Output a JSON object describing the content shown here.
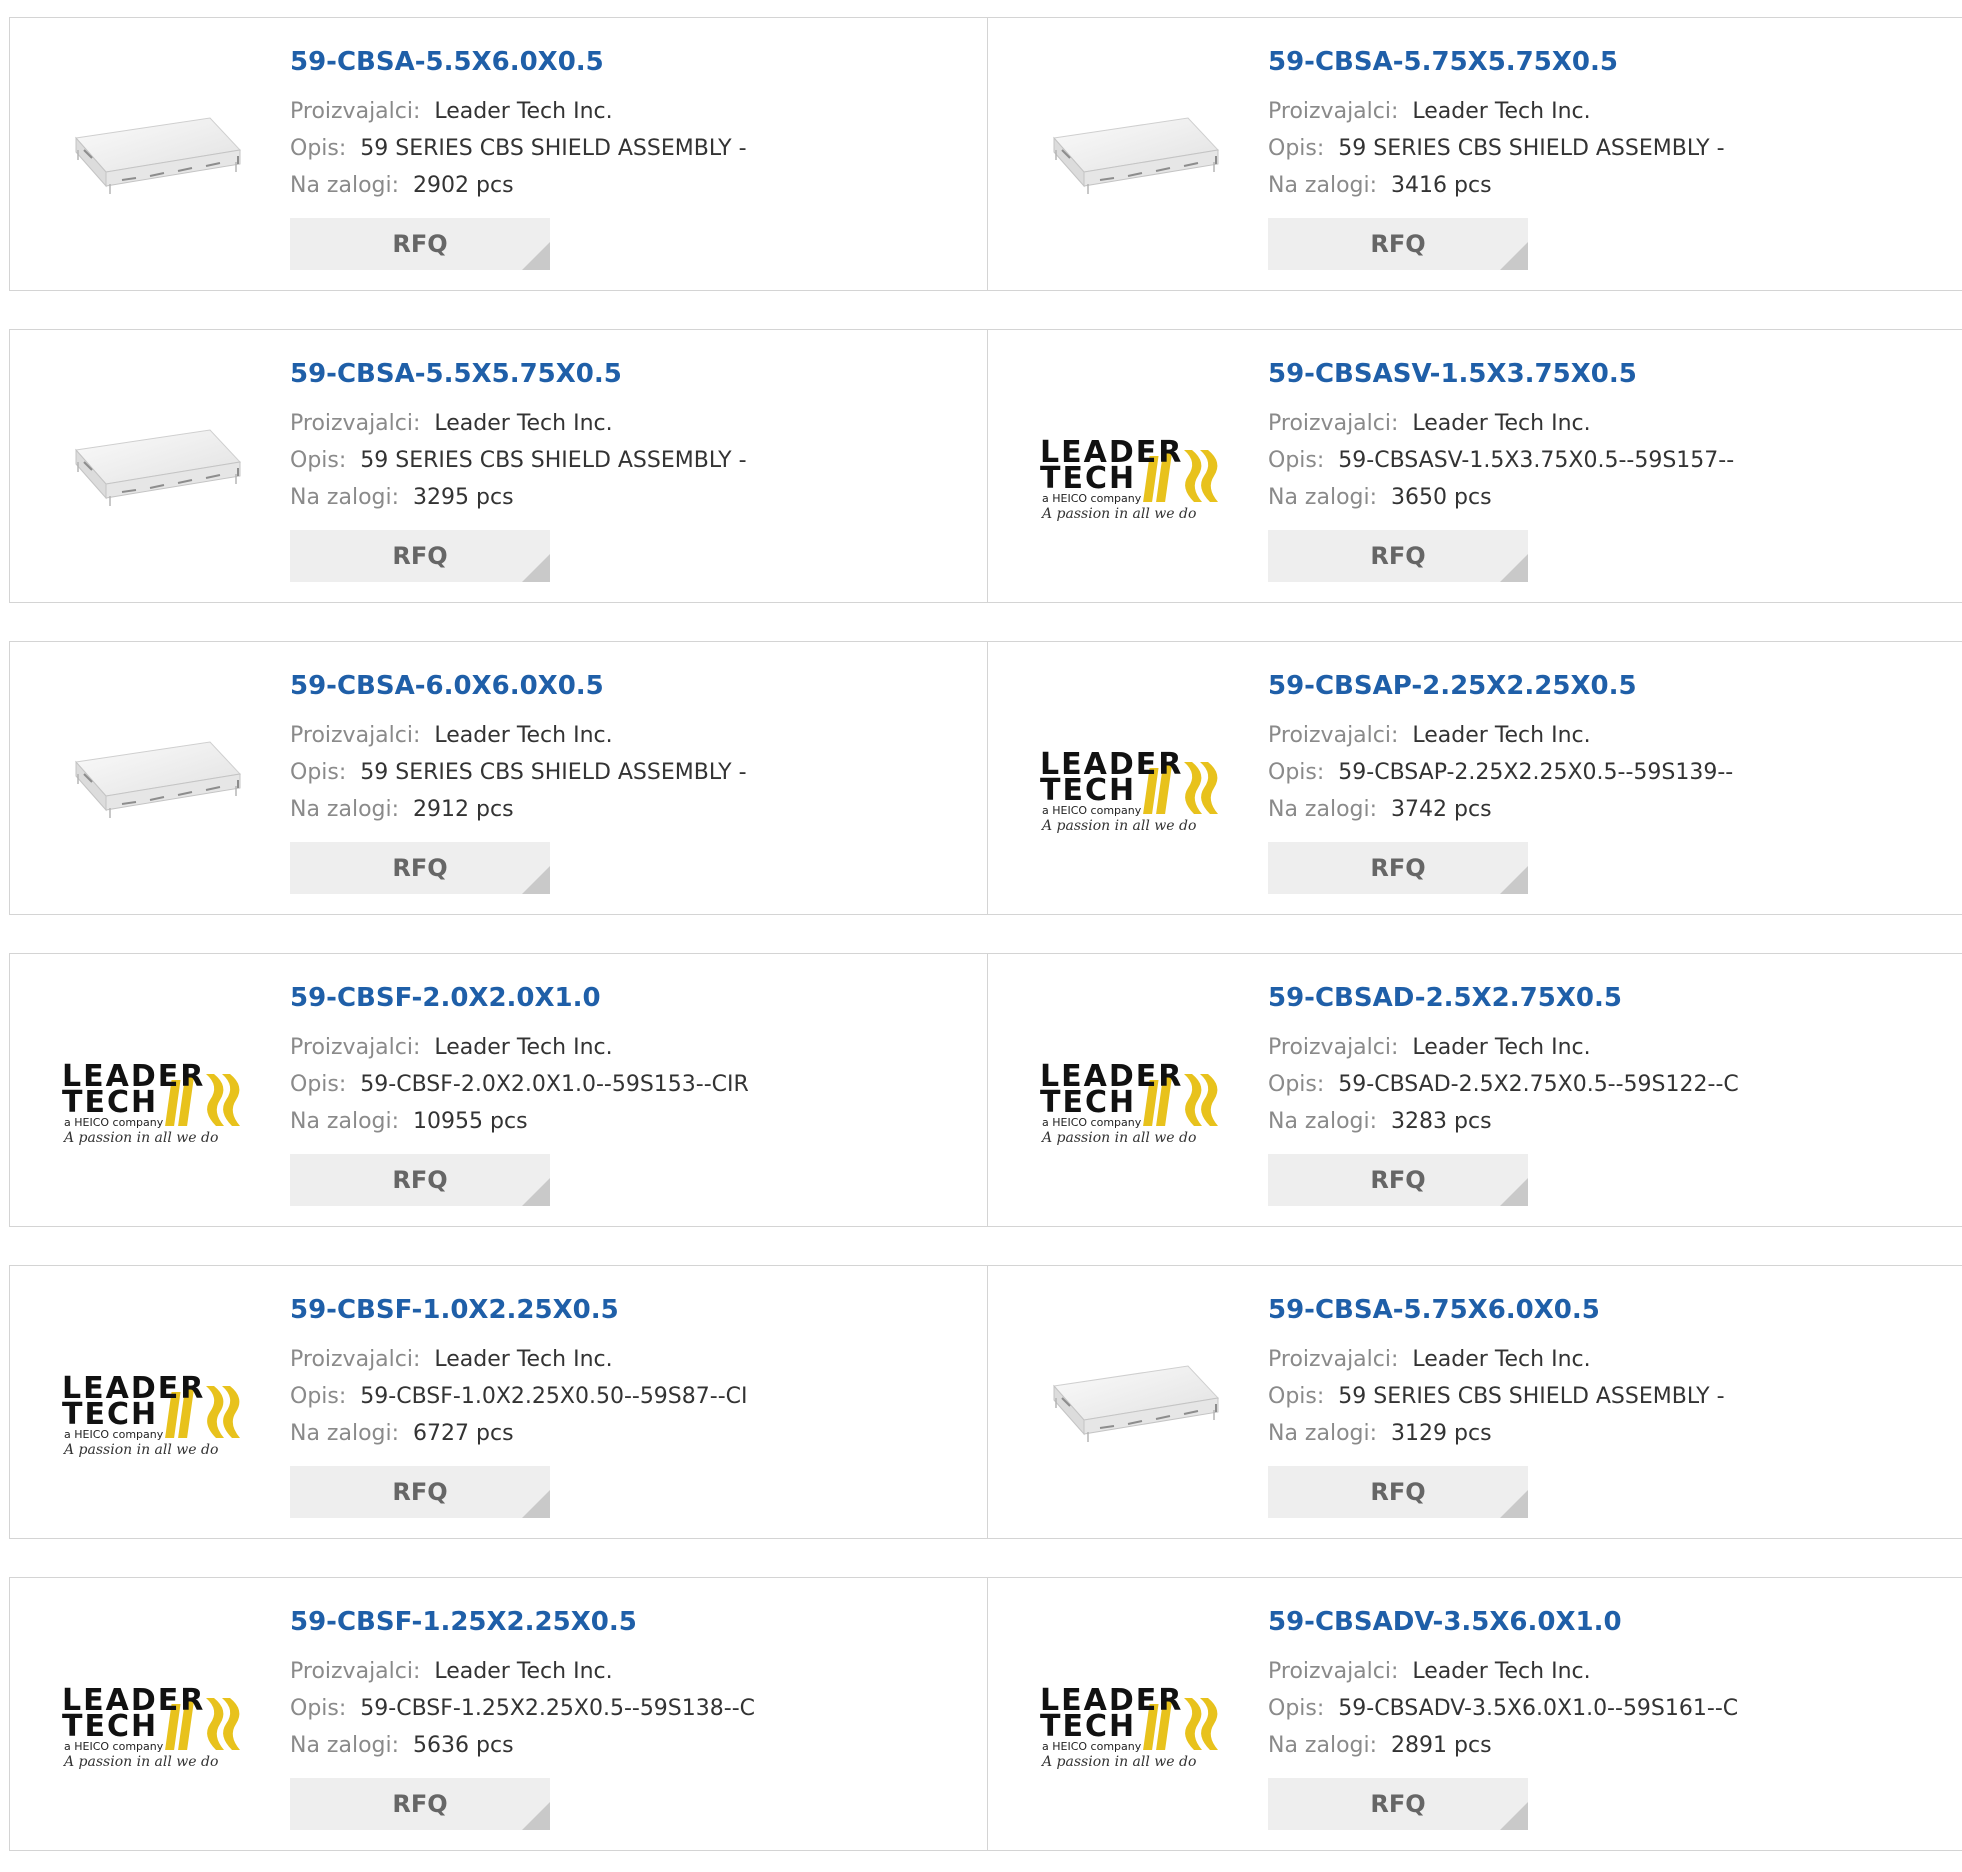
{
  "labels": {
    "manufacturer": "Proizvajalci:",
    "description": "Opis:",
    "stock": "Na zalogi:",
    "rfq": "RFQ"
  },
  "logo": {
    "line1": "LEADER",
    "line2": "TECH",
    "line3": "a HEICO company",
    "line4": "A passion in all we do"
  },
  "products": [
    {
      "part": "59-CBSA-5.5X6.0X0.5",
      "manufacturer": "Leader Tech Inc.",
      "description": "59 SERIES CBS SHIELD ASSEMBLY -",
      "stock": "2902 pcs",
      "image": "shield-can-icon"
    },
    {
      "part": "59-CBSA-5.75X5.75X0.5",
      "manufacturer": "Leader Tech Inc.",
      "description": "59 SERIES CBS SHIELD ASSEMBLY -",
      "stock": "3416 pcs",
      "image": "shield-can-icon"
    },
    {
      "part": "59-CBSA-5.5X5.75X0.5",
      "manufacturer": "Leader Tech Inc.",
      "description": "59 SERIES CBS SHIELD ASSEMBLY -",
      "stock": "3295 pcs",
      "image": "shield-can-icon"
    },
    {
      "part": "59-CBSASV-1.5X3.75X0.5",
      "manufacturer": "Leader Tech Inc.",
      "description": "59-CBSASV-1.5X3.75X0.5--59S157--",
      "stock": "3650 pcs",
      "image": "leader-tech-logo"
    },
    {
      "part": "59-CBSA-6.0X6.0X0.5",
      "manufacturer": "Leader Tech Inc.",
      "description": "59 SERIES CBS SHIELD ASSEMBLY -",
      "stock": "2912 pcs",
      "image": "shield-can-icon"
    },
    {
      "part": "59-CBSAP-2.25X2.25X0.5",
      "manufacturer": "Leader Tech Inc.",
      "description": "59-CBSAP-2.25X2.25X0.5--59S139--",
      "stock": "3742 pcs",
      "image": "leader-tech-logo"
    },
    {
      "part": "59-CBSF-2.0X2.0X1.0",
      "manufacturer": "Leader Tech Inc.",
      "description": "59-CBSF-2.0X2.0X1.0--59S153--CIR",
      "stock": "10955 pcs",
      "image": "leader-tech-logo"
    },
    {
      "part": "59-CBSAD-2.5X2.75X0.5",
      "manufacturer": "Leader Tech Inc.",
      "description": "59-CBSAD-2.5X2.75X0.5--59S122--C",
      "stock": "3283 pcs",
      "image": "leader-tech-logo"
    },
    {
      "part": "59-CBSF-1.0X2.25X0.5",
      "manufacturer": "Leader Tech Inc.",
      "description": "59-CBSF-1.0X2.25X0.50--59S87--CI",
      "stock": "6727 pcs",
      "image": "leader-tech-logo"
    },
    {
      "part": "59-CBSA-5.75X6.0X0.5",
      "manufacturer": "Leader Tech Inc.",
      "description": "59 SERIES CBS SHIELD ASSEMBLY -",
      "stock": "3129 pcs",
      "image": "shield-can-icon"
    },
    {
      "part": "59-CBSF-1.25X2.25X0.5",
      "manufacturer": "Leader Tech Inc.",
      "description": "59-CBSF-1.25X2.25X0.5--59S138--C",
      "stock": "5636 pcs",
      "image": "leader-tech-logo"
    },
    {
      "part": "59-CBSADV-3.5X6.0X1.0",
      "manufacturer": "Leader Tech Inc.",
      "description": "59-CBSADV-3.5X6.0X1.0--59S161--C",
      "stock": "2891 pcs",
      "image": "leader-tech-logo"
    }
  ],
  "colors": {
    "title": "#1f5fa8",
    "label": "#8a8a8a",
    "value": "#333333",
    "rfq_bg": "#eeeeee",
    "border": "#d4d4d4",
    "logo_yellow": "#e8c21c"
  }
}
